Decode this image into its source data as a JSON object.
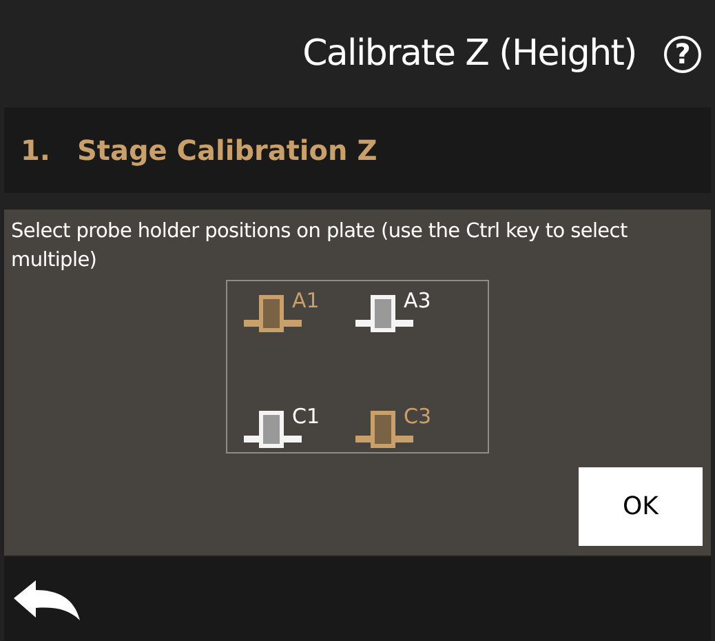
{
  "header": {
    "title": "Calibrate Z (Height)",
    "help": "?"
  },
  "step": {
    "number": "1.",
    "title": "Stage Calibration Z"
  },
  "instructions": "Select probe holder positions on plate (use the Ctrl key to select multiple)",
  "holders": [
    {
      "label": "A1",
      "selected": true
    },
    {
      "label": "A3",
      "selected": false
    },
    {
      "label": "C1",
      "selected": false
    },
    {
      "label": "C3",
      "selected": true
    }
  ],
  "buttons": [
    "OK"
  ]
}
